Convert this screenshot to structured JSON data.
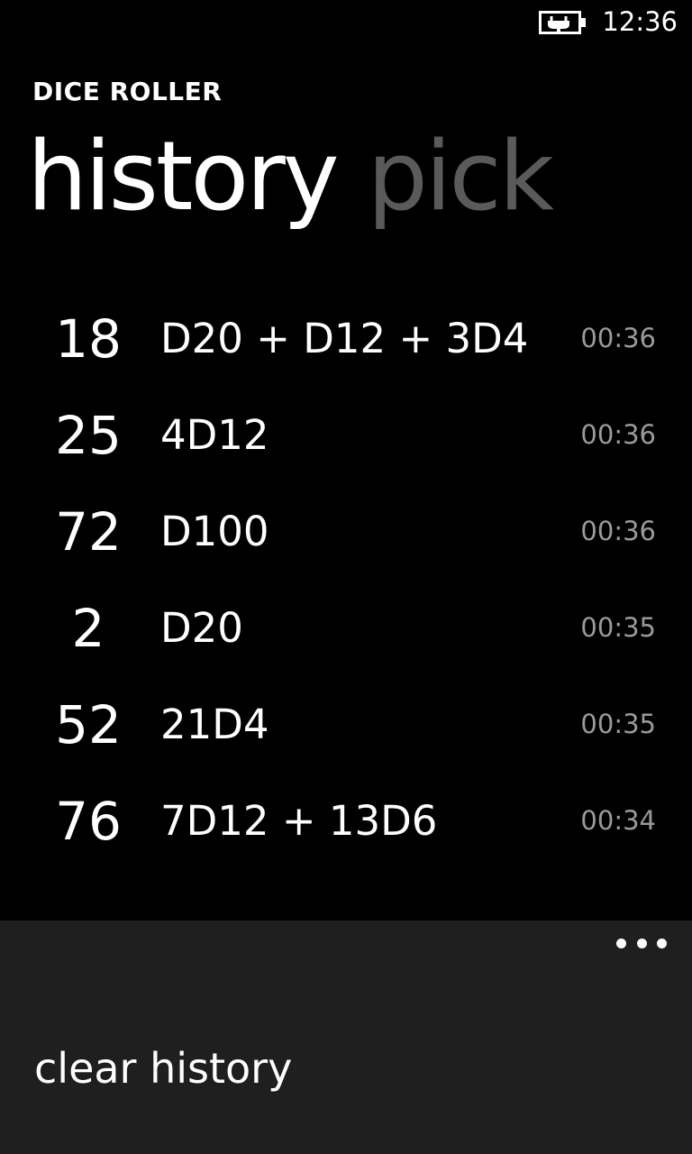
{
  "status_bar": {
    "time": "12:36",
    "battery_icon": "battery-charging-icon"
  },
  "app": {
    "title": "DICE ROLLER"
  },
  "pivot": {
    "items": [
      {
        "label": "history",
        "active": true
      },
      {
        "label": "pick",
        "active": false
      }
    ]
  },
  "history": {
    "rows": [
      {
        "result": "18",
        "expression": "D20 + D12 + 3D4",
        "time": "00:36"
      },
      {
        "result": "25",
        "expression": "4D12",
        "time": "00:36"
      },
      {
        "result": "72",
        "expression": "D100",
        "time": "00:36"
      },
      {
        "result": "2",
        "expression": "D20",
        "time": "00:35"
      },
      {
        "result": "52",
        "expression": "21D4",
        "time": "00:35"
      },
      {
        "result": "76",
        "expression": "7D12 + 13D6",
        "time": "00:34"
      }
    ]
  },
  "app_bar": {
    "more_icon": "ellipsis-icon",
    "menu_items": [
      {
        "label": "clear history"
      }
    ]
  },
  "colors": {
    "background": "#000000",
    "app_bar_background": "#1f1f1f",
    "inactive_pivot": "#5a5a5a",
    "secondary_text": "#9a9a9a"
  }
}
